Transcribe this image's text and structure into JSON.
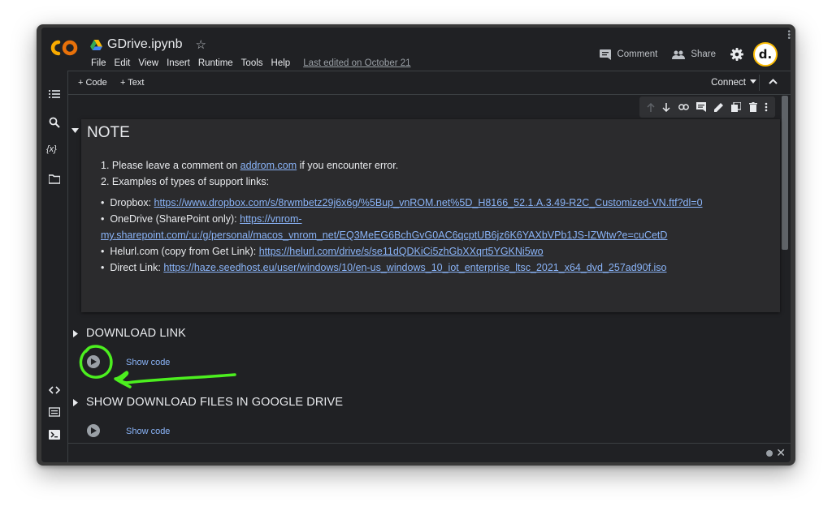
{
  "header": {
    "logo_text": "CO",
    "notebook_name": "GDrive.ipynb",
    "menus": [
      "File",
      "Edit",
      "View",
      "Insert",
      "Runtime",
      "Tools",
      "Help"
    ],
    "last_edited": "Last edited on October 21",
    "comment_label": "Comment",
    "share_label": "Share",
    "avatar_letter": "d."
  },
  "toolbar": {
    "add_code": "+ Code",
    "add_text": "+ Text",
    "connect": "Connect"
  },
  "note": {
    "title": "NOTE",
    "ordered": [
      {
        "pre": "Please leave a comment on ",
        "link": "addrom.com",
        "post": " if you encounter error."
      },
      {
        "pre": "Examples of types of support links:",
        "link": "",
        "post": ""
      }
    ],
    "links": [
      {
        "label": "Dropbox: ",
        "url": "https://www.dropbox.com/s/8rwmbetz29j6x6g/%5Bup_vnROM.net%5D_H8166_52.1.A.3.49-R2C_Customized-VN.ftf?dl=0"
      },
      {
        "label": "OneDrive (SharePoint only): ",
        "url_part1": "https://vnrom-",
        "url_part2": "my.sharepoint.com/:u:/g/personal/macos_vnrom_net/EQ3MeEG6BchGvG0AC6qcptUB6jz6K6YAXbVPb1JS-IZWtw?e=cuCetD"
      },
      {
        "label": "Helurl.com (copy from Get Link): ",
        "url": "https://helurl.com/drive/s/se11dQDKiCi5zhGbXXqrt5YGKNi5wo"
      },
      {
        "label": "Direct Link: ",
        "url": "https://haze.seedhost.eu/user/windows/10/en-us_windows_10_iot_enterprise_ltsc_2021_x64_dvd_257ad90f.iso"
      }
    ]
  },
  "sections": [
    {
      "title": "DOWNLOAD LINK",
      "show_code": "Show code"
    },
    {
      "title": "SHOW DOWNLOAD FILES IN GOOGLE DRIVE",
      "show_code": "Show code"
    }
  ],
  "colors": {
    "background": "#202124",
    "link": "#8ab4f8",
    "annotation": "#4cef1f",
    "logo_orange": "#f9ab00"
  }
}
